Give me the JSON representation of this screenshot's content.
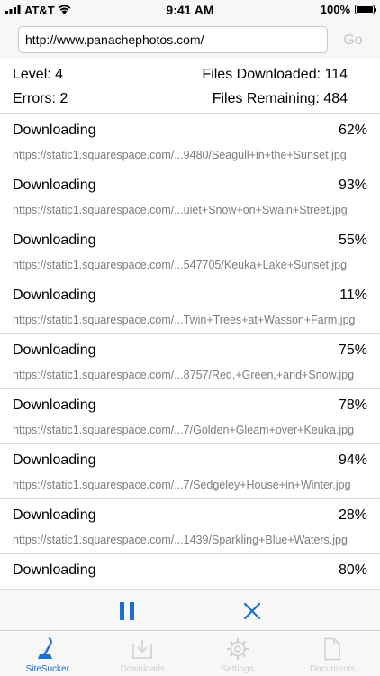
{
  "status_bar": {
    "carrier": "AT&T",
    "time": "9:41 AM",
    "battery": "100%",
    "wifi_icon": "wifi-icon",
    "battery_icon": "battery-icon"
  },
  "url_bar": {
    "value": "http://www.panachephotos.com/",
    "go_label": "Go"
  },
  "summary": {
    "level": "Level: 4",
    "files_downloaded": "Files Downloaded: 114",
    "errors": "Errors: 2",
    "files_remaining": "Files Remaining: 484"
  },
  "downloads": [
    {
      "status": "Downloading",
      "percent": "62%",
      "url": "https://static1.squarespace.com/...9480/Seagull+in+the+Sunset.jpg"
    },
    {
      "status": "Downloading",
      "percent": "93%",
      "url": "https://static1.squarespace.com/...uiet+Snow+on+Swain+Street.jpg"
    },
    {
      "status": "Downloading",
      "percent": "55%",
      "url": "https://static1.squarespace.com/...547705/Keuka+Lake+Sunset.jpg"
    },
    {
      "status": "Downloading",
      "percent": "11%",
      "url": "https://static1.squarespace.com/...Twin+Trees+at+Wasson+Farm.jpg"
    },
    {
      "status": "Downloading",
      "percent": "75%",
      "url": "https://static1.squarespace.com/...8757/Red,+Green,+and+Snow.jpg"
    },
    {
      "status": "Downloading",
      "percent": "78%",
      "url": "https://static1.squarespace.com/...7/Golden+Gleam+over+Keuka.jpg"
    },
    {
      "status": "Downloading",
      "percent": "94%",
      "url": "https://static1.squarespace.com/...7/Sedgeley+House+in+Winter.jpg"
    },
    {
      "status": "Downloading",
      "percent": "28%",
      "url": "https://static1.squarespace.com/...1439/Sparkling+Blue+Waters.jpg"
    },
    {
      "status": "Downloading",
      "percent": "80%",
      "url": ""
    }
  ],
  "controls": {
    "pause_icon": "pause-icon",
    "stop_icon": "close-icon",
    "accent": "#1a6fd1"
  },
  "tabs": [
    {
      "label": "SiteSucker",
      "icon": "sitesucker-vacuum-icon",
      "active": true
    },
    {
      "label": "Downloads",
      "icon": "downloads-tray-icon",
      "active": false
    },
    {
      "label": "Settings",
      "icon": "gear-icon",
      "active": false
    },
    {
      "label": "Documents",
      "icon": "document-icon",
      "active": false
    }
  ]
}
